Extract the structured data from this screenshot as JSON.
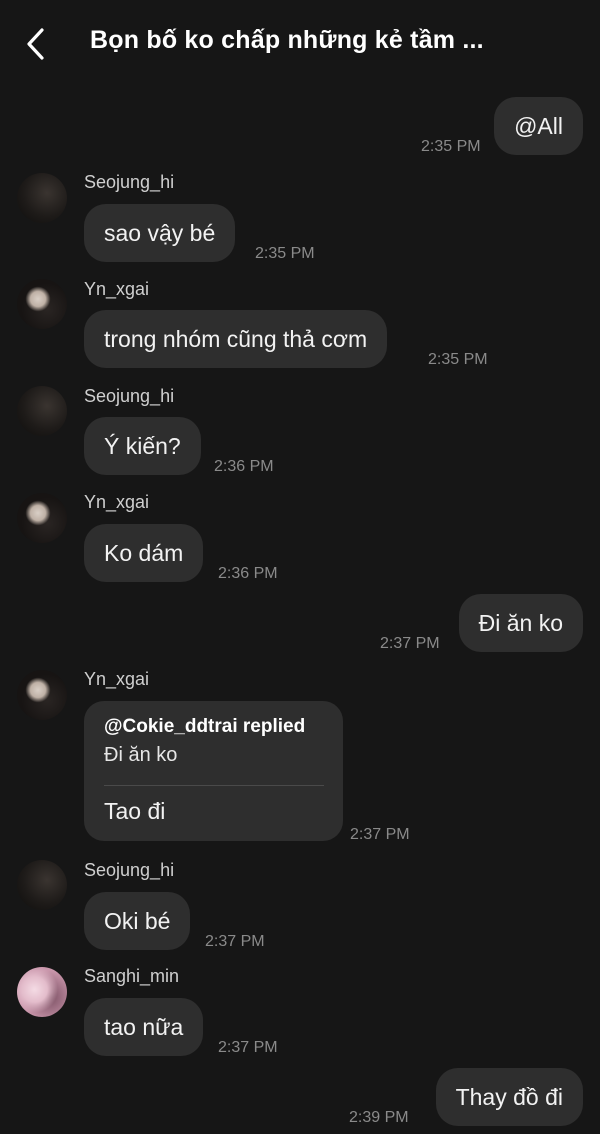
{
  "header": {
    "back_icon": "chevron-left-icon",
    "title": "Bọn bố ko chấp những kẻ tầm ..."
  },
  "messages": [
    {
      "type": "outgoing",
      "text": "@All",
      "time": "2:35 PM"
    },
    {
      "type": "incoming",
      "sender": "Seojung_hi",
      "text": "sao vậy bé",
      "time": "2:35 PM"
    },
    {
      "type": "incoming",
      "sender": "Yn_xgai",
      "text": "trong nhóm cũng thả cơm",
      "time": "2:35 PM"
    },
    {
      "type": "incoming",
      "sender": "Seojung_hi",
      "text": "Ý kiến?",
      "time": "2:36 PM"
    },
    {
      "type": "incoming",
      "sender": "Yn_xgai",
      "text": "Ko dám",
      "time": "2:36 PM"
    },
    {
      "type": "outgoing",
      "text": "Đi ăn ko",
      "time": "2:37 PM"
    },
    {
      "type": "incoming-reply",
      "sender": "Yn_xgai",
      "reply_header": "@Cokie_ddtrai replied",
      "quoted": "Đi ăn ko",
      "text": "Tao đi",
      "time": "2:37 PM"
    },
    {
      "type": "incoming",
      "sender": "Seojung_hi",
      "text": "Oki bé",
      "time": "2:37 PM"
    },
    {
      "type": "incoming",
      "sender": "Sanghi_min",
      "text": "tao nữa",
      "time": "2:37 PM"
    },
    {
      "type": "outgoing",
      "text": "Thay đồ đi",
      "time": "2:39 PM"
    }
  ]
}
